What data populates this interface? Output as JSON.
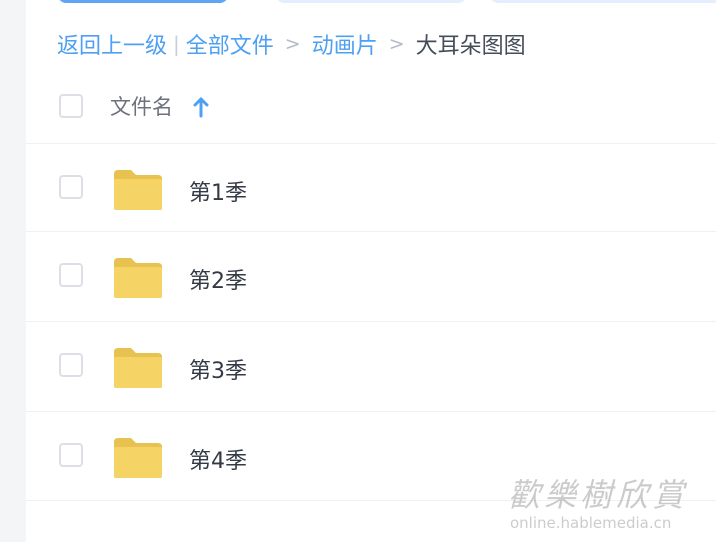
{
  "breadcrumb": {
    "back": "返回上一级",
    "all_files": "全部文件",
    "folder": "动画片",
    "current": "大耳朵图图",
    "separator_bar": "|",
    "arrow": ">"
  },
  "table": {
    "header": {
      "name_label": "文件名",
      "sort": "ascending"
    },
    "rows": [
      {
        "name": "第1季",
        "icon": "folder-icon"
      },
      {
        "name": "第2季",
        "icon": "folder-icon"
      },
      {
        "name": "第3季",
        "icon": "folder-icon"
      },
      {
        "name": "第4季",
        "icon": "folder-icon"
      }
    ]
  },
  "watermark": {
    "seal": "歡樂樹欣賞",
    "url": "online.hablemedia.cn"
  },
  "colors": {
    "accent": "#4ea0f3",
    "folder": "#f6d365",
    "folder_tab": "#e7c251",
    "text": "#333a45",
    "divider": "#eef1f5"
  }
}
